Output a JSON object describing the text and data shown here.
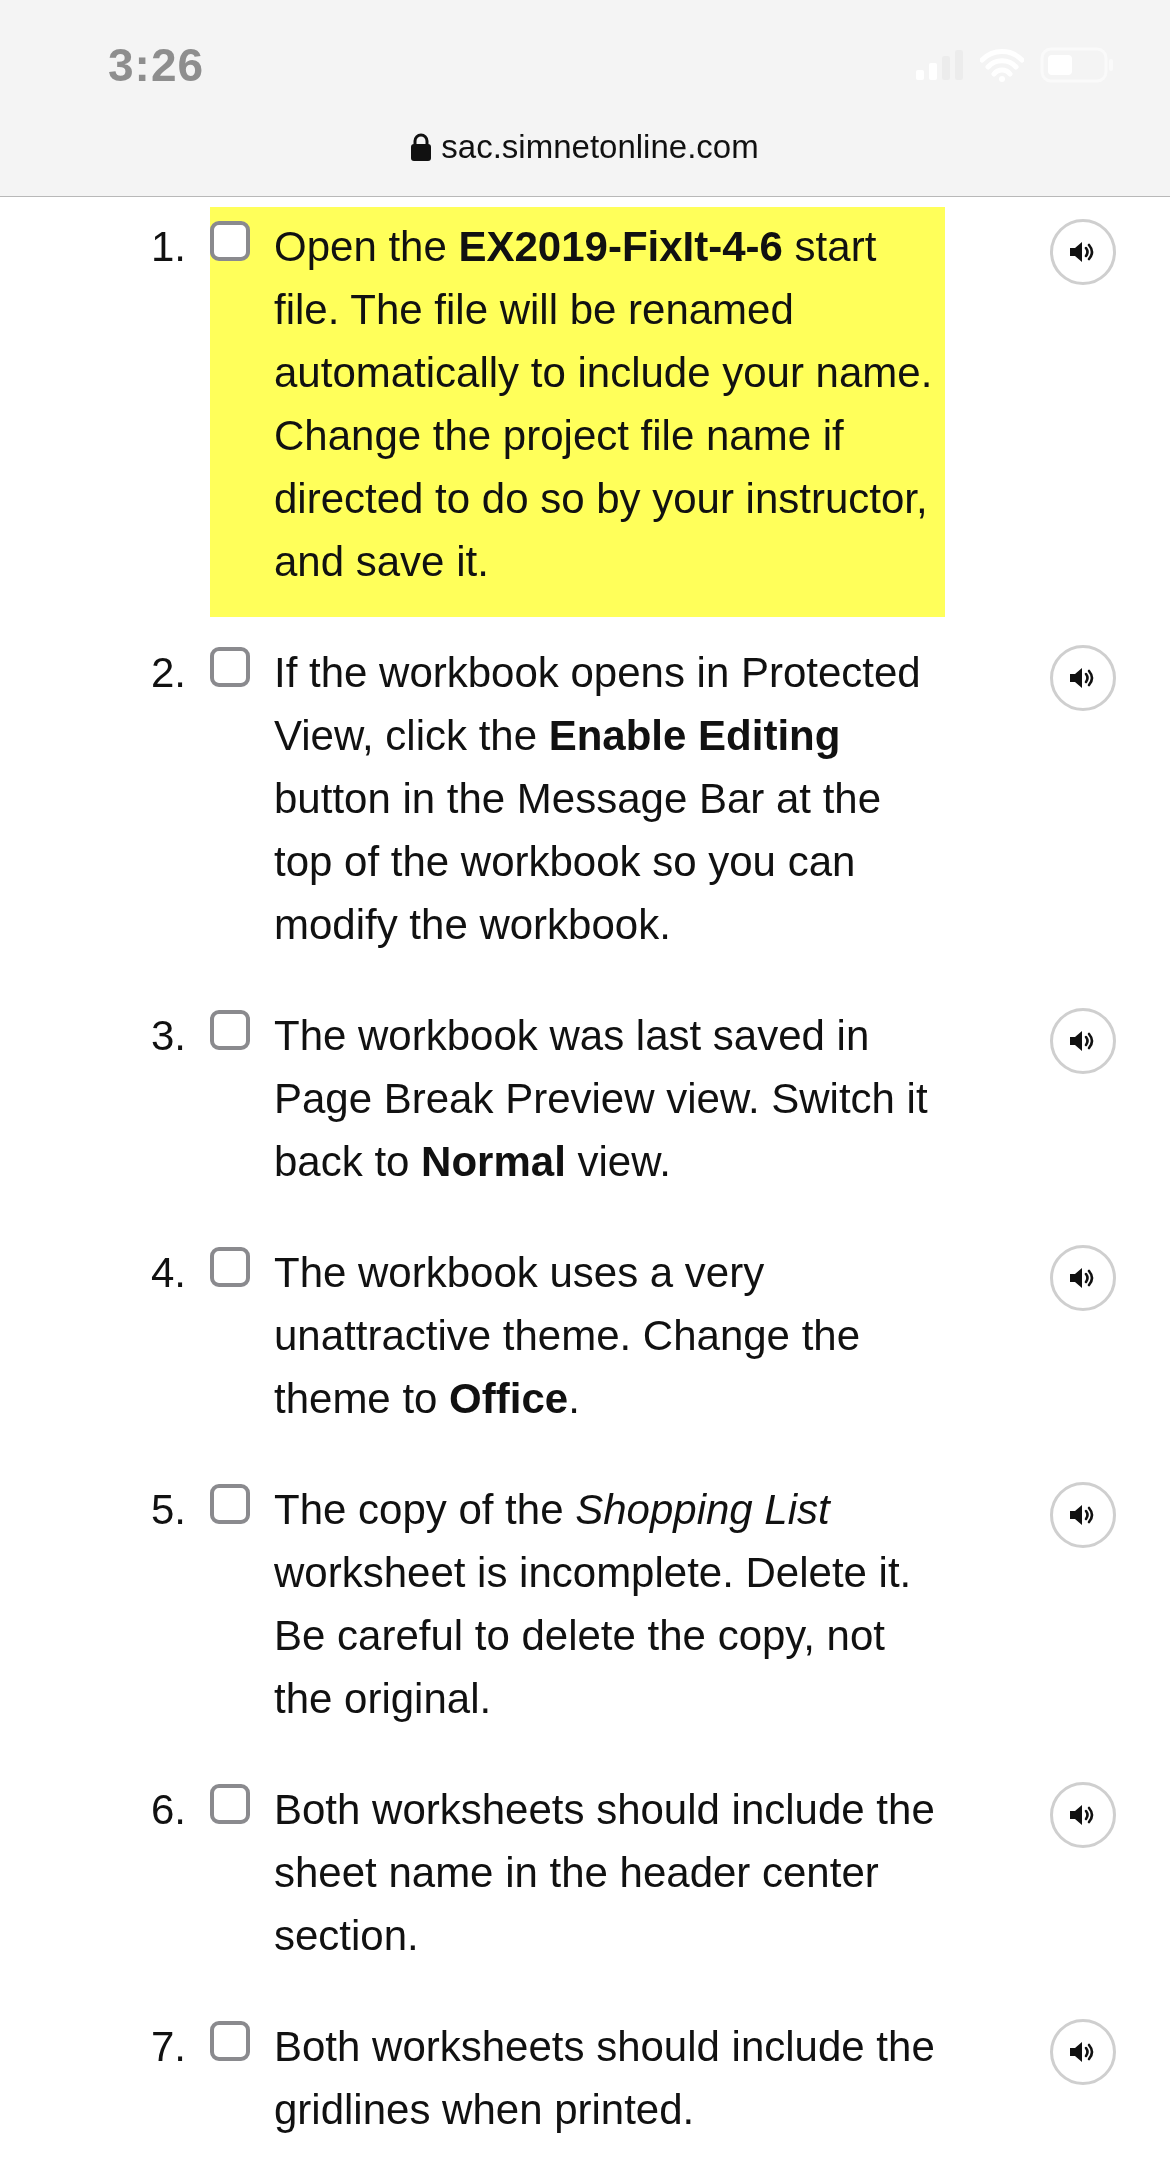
{
  "status_bar": {
    "time": "3:26"
  },
  "address_bar": {
    "url": "sac.simnetonline.com"
  },
  "steps": [
    {
      "number": "1.",
      "text": "Open the **EX2019-FixIt-4-6** start file. The file will be renamed automatically to include your name. Change the project file name if directed to do so by your instructor, and save it.",
      "checked": false,
      "highlighted": true
    },
    {
      "number": "2.",
      "text": "If the workbook opens in Protected View, click the **Enable Editing** button in the Message Bar at the top of the workbook so you can modify the workbook.",
      "checked": false,
      "highlighted": false
    },
    {
      "number": "3.",
      "text": "The workbook was last saved in Page Break Preview view. Switch it back to **Normal** view.",
      "checked": false,
      "highlighted": false
    },
    {
      "number": "4.",
      "text": "The workbook uses a very unattractive theme. Change the theme to **Office**.",
      "checked": false,
      "highlighted": false
    },
    {
      "number": "5.",
      "text": "The copy of the *Shopping List* worksheet is incomplete. Delete it. Be careful to delete the copy, not the original.",
      "checked": false,
      "highlighted": false
    },
    {
      "number": "6.",
      "text": "Both worksheets should include the sheet name in the header center section.",
      "checked": false,
      "highlighted": false
    },
    {
      "number": "7.",
      "text": "Both worksheets should include the gridlines when printed.",
      "checked": false,
      "highlighted": false
    }
  ]
}
